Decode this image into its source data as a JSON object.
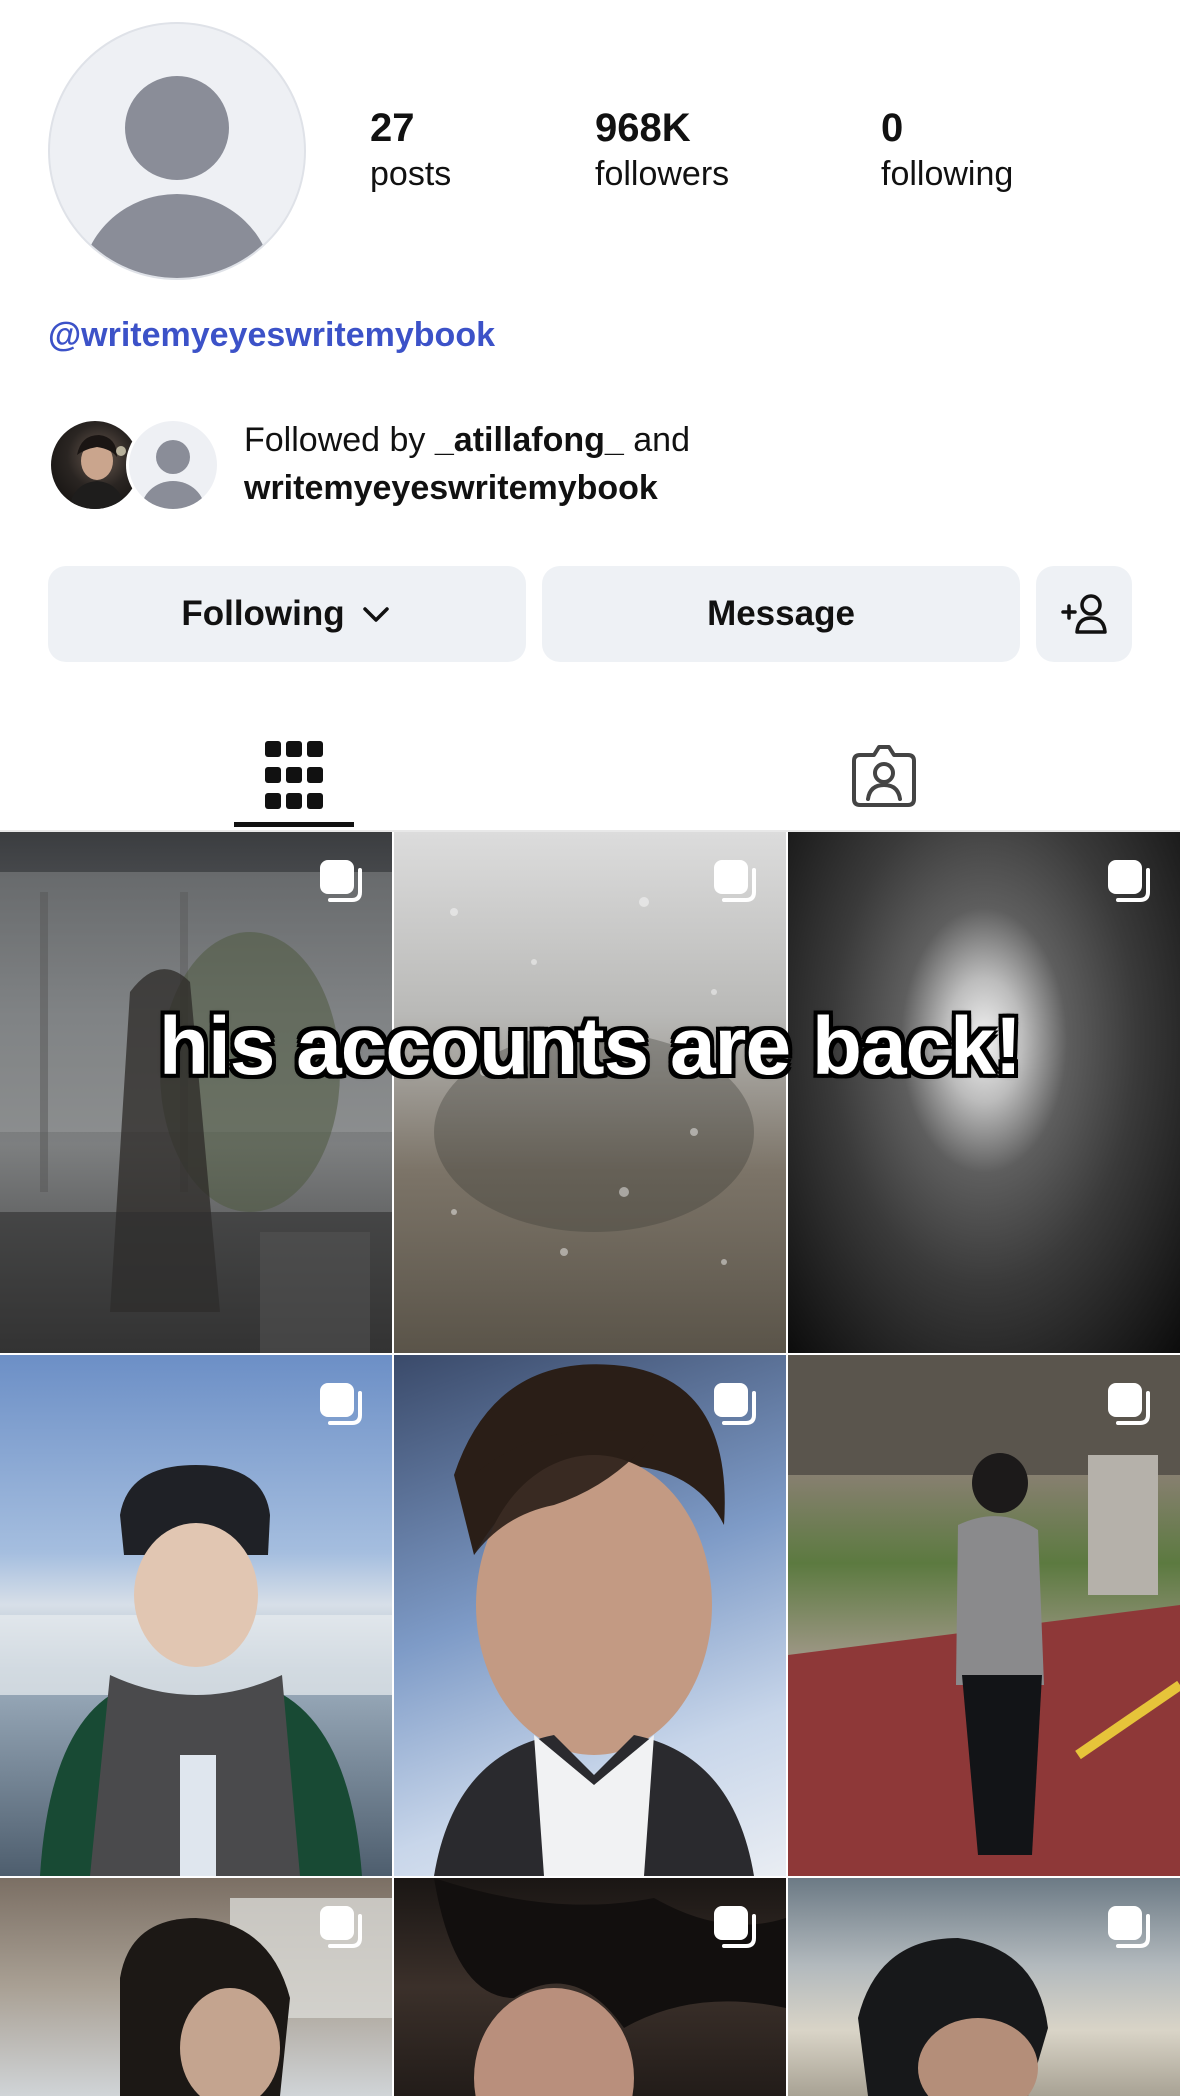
{
  "profile": {
    "handle": "@writemyeyeswritemybook",
    "stats": [
      {
        "value": "27",
        "label": "posts"
      },
      {
        "value": "968K",
        "label": "followers"
      },
      {
        "value": "0",
        "label": "following"
      }
    ]
  },
  "followed_by": {
    "prefix": "Followed by ",
    "user1": "_atillafong_",
    "joiner": " and",
    "user2": "writemyeyeswritemybook"
  },
  "actions": {
    "following_label": "Following",
    "message_label": "Message"
  },
  "tabs": [
    {
      "name": "grid",
      "icon": "grid-icon",
      "active": true
    },
    {
      "name": "tagged",
      "icon": "tagged-person-icon",
      "active": false
    }
  ],
  "overlay_caption": "his accounts are back!",
  "colors": {
    "handle_link": "#3c52c8",
    "button_bg": "#eef1f5",
    "avatar_placeholder": "#8a8d98"
  }
}
